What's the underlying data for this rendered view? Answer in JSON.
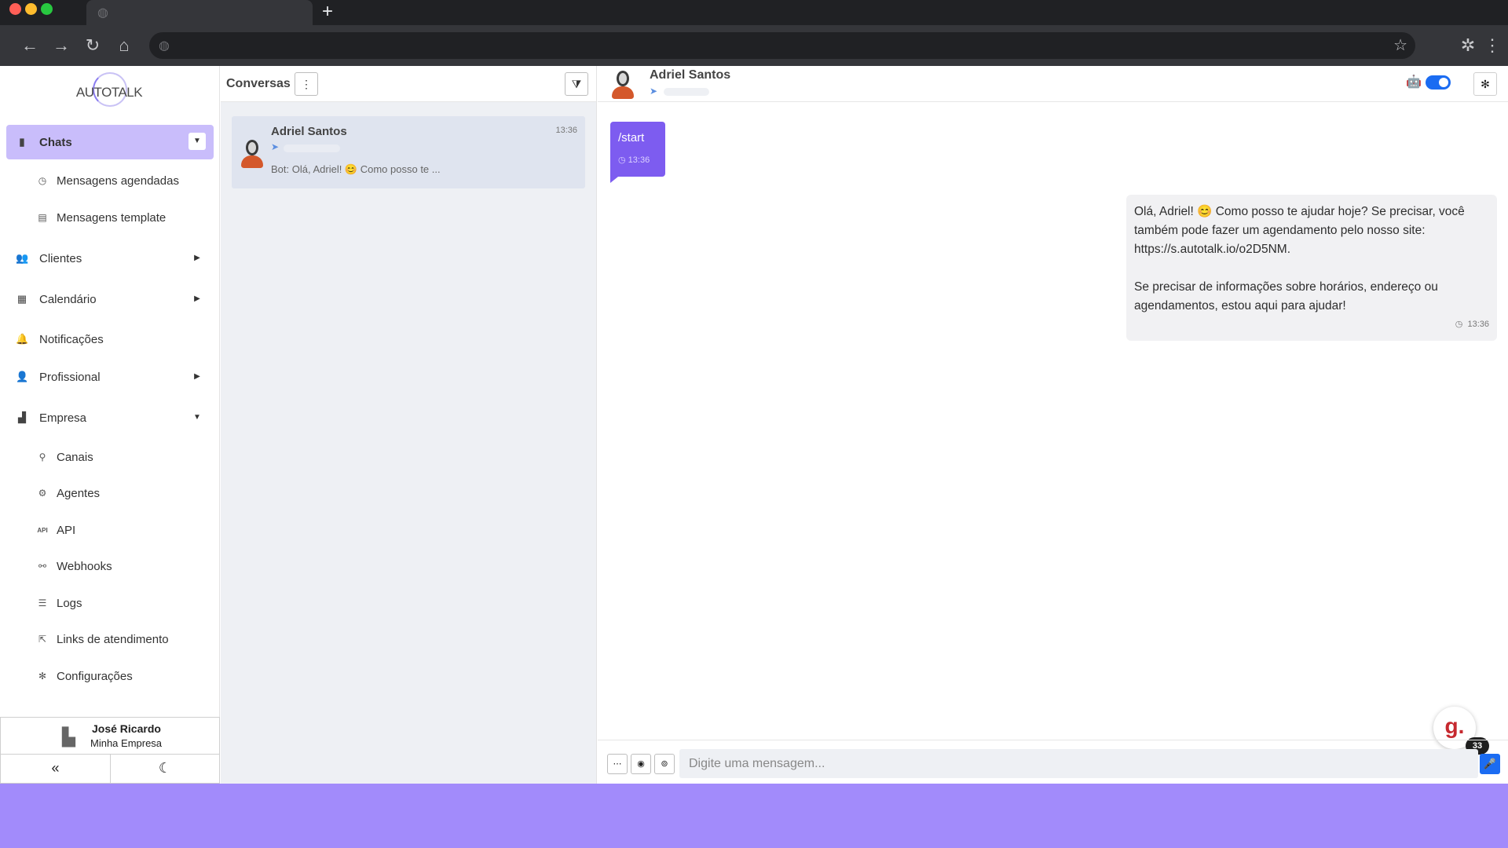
{
  "browser": {
    "new_tab": "+",
    "nav_back": "←",
    "nav_forward": "→",
    "nav_reload": "↻",
    "nav_home": "⌂"
  },
  "sidebar": {
    "logo_text": "AUTOTALK",
    "items": [
      {
        "label": "Chats",
        "icon": "chat-icon",
        "active": true
      },
      {
        "label": "Mensagens agendadas",
        "icon": "clock-icon",
        "sub": true
      },
      {
        "label": "Mensagens template",
        "icon": "template-icon",
        "sub": true
      },
      {
        "label": "Clientes",
        "icon": "users-icon"
      },
      {
        "label": "Calendário",
        "icon": "calendar-icon"
      },
      {
        "label": "Notificações",
        "icon": "bell-icon"
      },
      {
        "label": "Profissional",
        "icon": "user-gear-icon"
      },
      {
        "label": "Empresa",
        "icon": "building-icon"
      },
      {
        "label": "Canais",
        "icon": "link-icon",
        "sub": true
      },
      {
        "label": "Agentes",
        "icon": "robot-icon",
        "sub": true
      },
      {
        "label": "API",
        "icon": "api-icon",
        "sub": true
      },
      {
        "label": "Webhooks",
        "icon": "webhook-icon",
        "sub": true
      },
      {
        "label": "Logs",
        "icon": "list-icon",
        "sub": true
      },
      {
        "label": "Links de atendimento",
        "icon": "external-link-icon",
        "sub": true
      },
      {
        "label": "Configurações",
        "icon": "gear-icon",
        "sub": true
      }
    ],
    "user": {
      "name": "José Ricardo",
      "company": "Minha Empresa"
    },
    "collapse_label": "«",
    "theme_label": "☾"
  },
  "conversations": {
    "title": "Conversas",
    "items": [
      {
        "name": "Adriel Santos",
        "time": "13:36",
        "preview": "Bot: Olá, Adriel! 😊 Como posso te ..."
      }
    ]
  },
  "chat": {
    "contact_name": "Adriel Santos",
    "bot_enabled": true,
    "messages": [
      {
        "direction": "in",
        "text": "/start",
        "time": "13:36"
      },
      {
        "direction": "out",
        "p1_l1": "Olá, Adriel! 😊 Como posso te ajudar hoje? Se precisar, você",
        "p1_l2": "também pode fazer um agendamento pelo nosso site:",
        "p1_l3": "https://s.autotalk.io/o2D5NM.",
        "p2_l1": "Se precisar de informações sobre horários, endereço ou",
        "p2_l2": "agendamentos, estou aqui para ajudar!",
        "time": "13:36"
      }
    ],
    "composer_placeholder": "Digite uma mensagem...",
    "widget_letter": "g.",
    "widget_badge": "33"
  },
  "colors": {
    "accent": "#7d5cf0",
    "active_nav": "#c9bdfb",
    "toggle": "#1b6cf2",
    "page_bg": "#a28bfb"
  }
}
